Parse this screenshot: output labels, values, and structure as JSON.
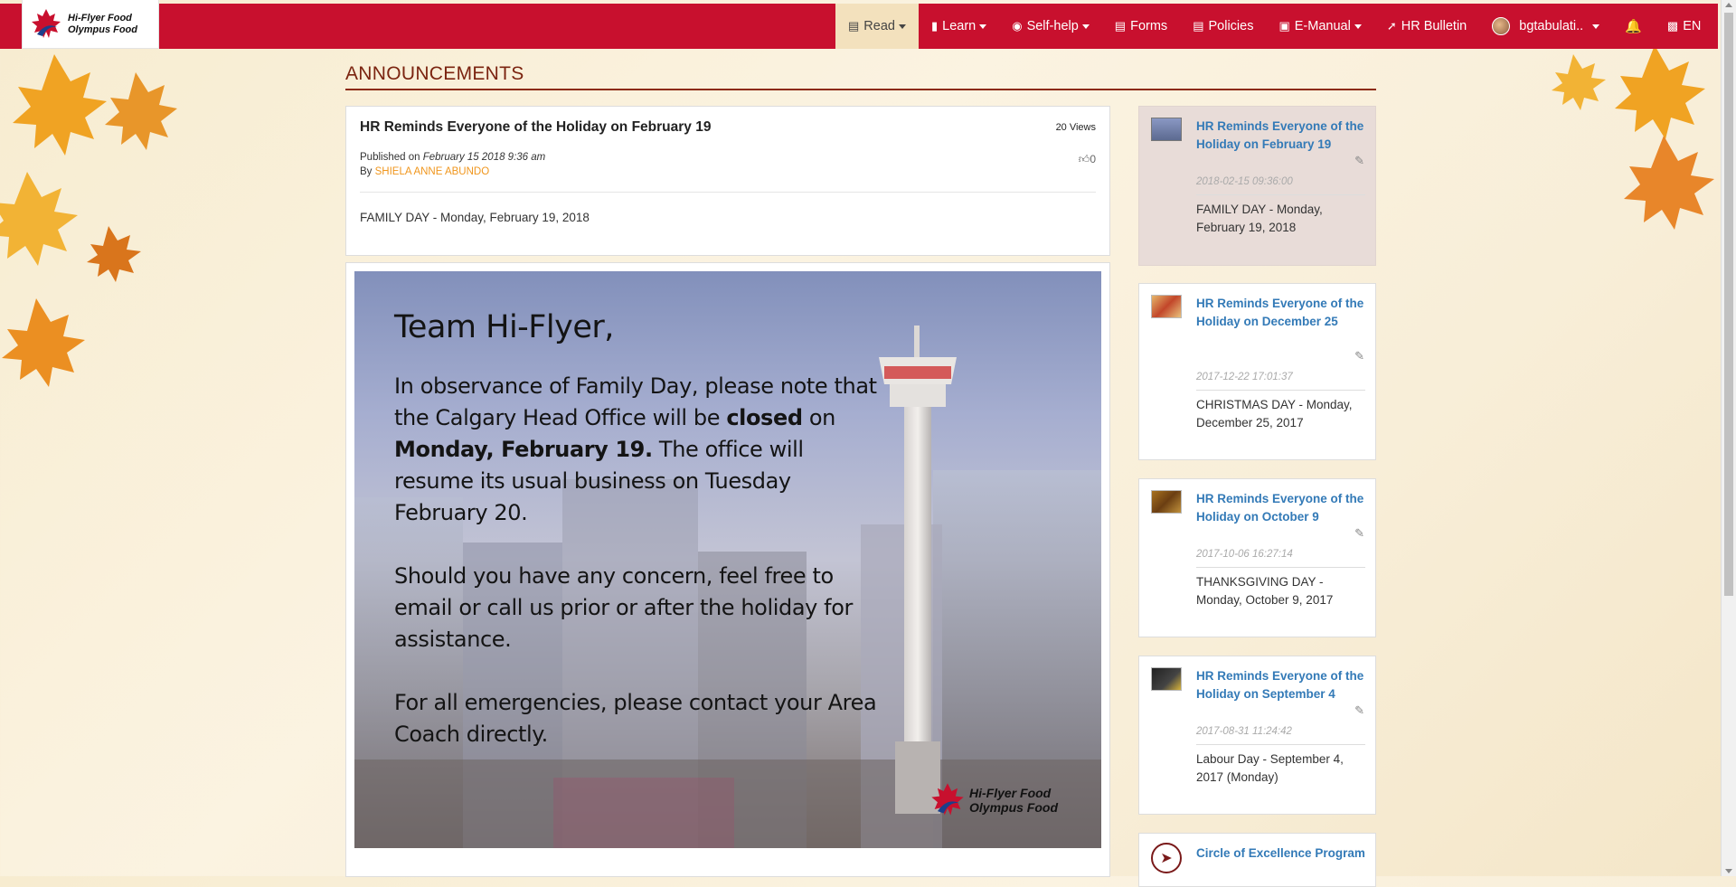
{
  "brand": {
    "line1": "Hi-Flyer Food",
    "line2": "Olympus Food"
  },
  "nav": {
    "items": [
      {
        "label": "Read",
        "icon": "newspaper-icon",
        "dropdown": true,
        "active": true
      },
      {
        "label": "Learn",
        "icon": "book-icon",
        "dropdown": true
      },
      {
        "label": "Self-help",
        "icon": "lifebuoy-icon",
        "dropdown": true
      },
      {
        "label": "Forms",
        "icon": "form-icon"
      },
      {
        "label": "Policies",
        "icon": "policy-icon"
      },
      {
        "label": "E-Manual",
        "icon": "manual-icon",
        "dropdown": true
      },
      {
        "label": "HR Bulletin",
        "icon": "pin-icon"
      },
      {
        "label": "bgtabulati..",
        "icon": "avatar",
        "dropdown": true
      },
      {
        "label": "",
        "icon": "bell-icon"
      },
      {
        "label": "EN",
        "icon": "language-icon"
      }
    ]
  },
  "page": {
    "title": "ANNOUNCEMENTS"
  },
  "post": {
    "title": "HR Reminds Everyone of the Holiday on February 19",
    "views": "20 Views",
    "published_prefix": "Published on",
    "published_date": "February 15 2018 9:36 am",
    "by_prefix": "By",
    "author": "SHIELA ANNE ABUNDO",
    "likes": "0",
    "summary": "FAMILY DAY - Monday, February 19, 2018"
  },
  "poster": {
    "heading": "Team Hi-Flyer,",
    "p1_a": "In observance of Family Day, please note that the Calgary Head Office will be ",
    "p1_b": "closed",
    "p1_c": " on ",
    "p1_d": "Monday, February 19.",
    "p1_e": " The office will resume its usual business on Tuesday February 20.",
    "p2": "Should you have any concern, feel free to email or call us prior or after the holiday for assistance.",
    "p3": "For all emergencies, please contact your Area Coach directly.",
    "logo_line1": "Hi-Flyer Food",
    "logo_line2": "Olympus Food"
  },
  "sidebar": {
    "items": [
      {
        "title": "HR Reminds Everyone of the Holiday on February 19",
        "date": "2018-02-15 09:36:00",
        "summary": "FAMILY DAY - Monday, February 19, 2018"
      },
      {
        "title": "HR Reminds Everyone of the Holiday on December 25",
        "date": "2017-12-22 17:01:37",
        "summary": "CHRISTMAS DAY - Monday, December 25, 2017"
      },
      {
        "title": "HR Reminds Everyone of the Holiday on October 9",
        "date": "2017-10-06 16:27:14",
        "summary": "THANKSGIVING DAY - Monday, October 9, 2017"
      },
      {
        "title": "HR Reminds Everyone of the Holiday on September 4",
        "date": "2017-08-31 11:24:42",
        "summary": "Labour Day - September 4, 2017 (Monday)"
      },
      {
        "title": "Circle of Excellence Program",
        "date": "",
        "summary": ""
      }
    ]
  }
}
